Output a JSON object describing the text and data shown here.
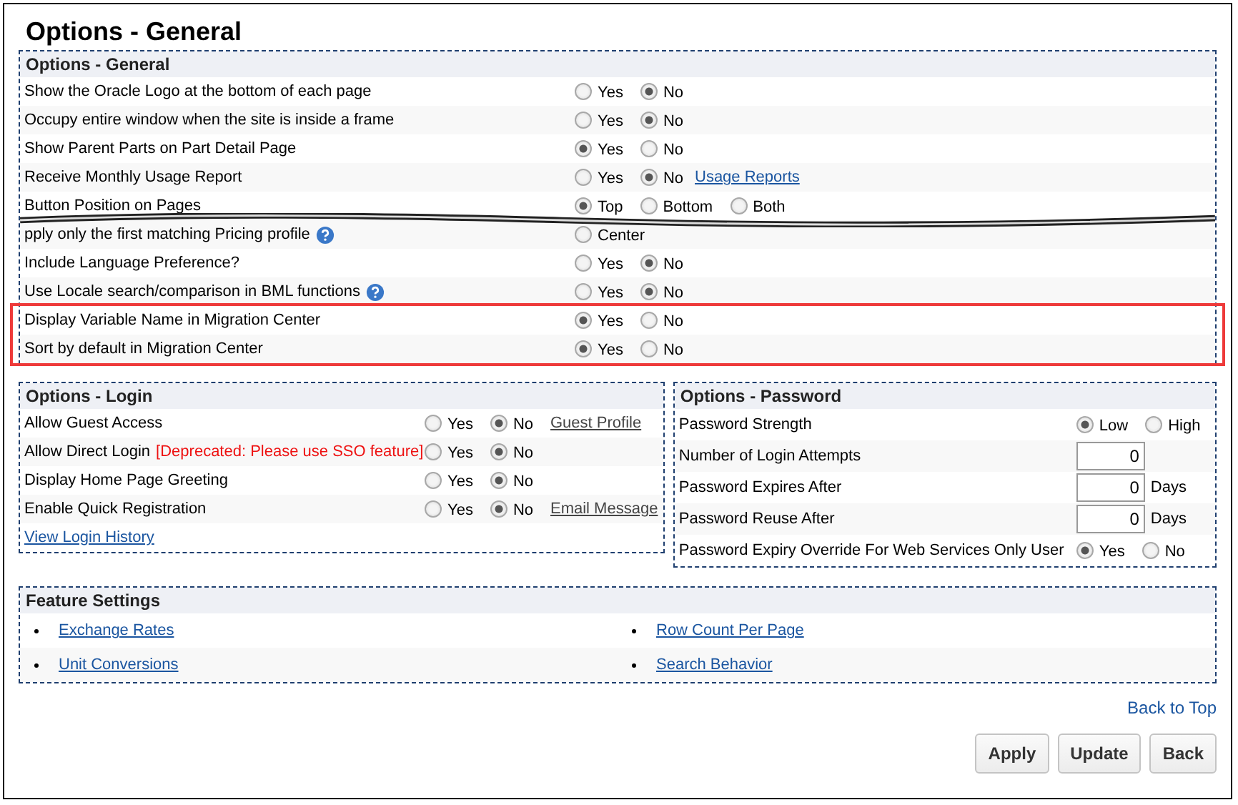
{
  "page_title": "Options - General",
  "general": {
    "title": "Options - General",
    "rows": [
      {
        "label": "Show the Oracle Logo at the bottom of each page",
        "help": false,
        "highlighted": false,
        "options": [
          {
            "label": "Yes",
            "selected": false
          },
          {
            "label": "No",
            "selected": true
          }
        ]
      },
      {
        "label": "Occupy entire window when the site is inside a frame",
        "help": false,
        "highlighted": false,
        "options": [
          {
            "label": "Yes",
            "selected": false
          },
          {
            "label": "No",
            "selected": true
          }
        ]
      },
      {
        "label": "Show Parent Parts on Part Detail Page",
        "help": false,
        "highlighted": false,
        "options": [
          {
            "label": "Yes",
            "selected": true
          },
          {
            "label": "No",
            "selected": false
          }
        ]
      },
      {
        "label": "Receive Monthly Usage Report",
        "help": false,
        "highlighted": false,
        "options": [
          {
            "label": "Yes",
            "selected": false
          },
          {
            "label": "No",
            "selected": true
          }
        ],
        "link": "Usage Reports"
      },
      {
        "label": "Button Position on Pages",
        "help": false,
        "highlighted": false,
        "options": [
          {
            "label": "Top",
            "selected": true
          },
          {
            "label": "Bottom",
            "selected": false
          },
          {
            "label": "Both",
            "selected": false
          }
        ],
        "tear_after": true
      },
      {
        "label": "pply only the first matching Pricing profile",
        "help": true,
        "highlighted": false,
        "options": [
          {
            "label": "Center",
            "selected": false
          }
        ]
      },
      {
        "label": "Include Language Preference?",
        "help": false,
        "highlighted": false,
        "options": [
          {
            "label": "Yes",
            "selected": false
          },
          {
            "label": "No",
            "selected": true
          }
        ]
      },
      {
        "label": "Use Locale search/comparison in BML functions",
        "help": true,
        "highlighted": false,
        "options": [
          {
            "label": "Yes",
            "selected": false
          },
          {
            "label": "No",
            "selected": true
          }
        ]
      },
      {
        "label": "Display Variable Name in Migration Center",
        "help": false,
        "highlighted": true,
        "options": [
          {
            "label": "Yes",
            "selected": true
          },
          {
            "label": "No",
            "selected": false
          }
        ]
      },
      {
        "label": "Sort by default in Migration Center",
        "help": false,
        "highlighted": true,
        "options": [
          {
            "label": "Yes",
            "selected": true
          },
          {
            "label": "No",
            "selected": false
          }
        ]
      }
    ]
  },
  "login": {
    "title": "Options - Login",
    "rows": [
      {
        "label": "Allow Guest Access",
        "options": [
          {
            "label": "Yes",
            "selected": false
          },
          {
            "label": "No",
            "selected": true
          }
        ],
        "link": "Guest Profile"
      },
      {
        "label": "Allow Direct Login",
        "warning": "[Deprecated: Please use SSO feature]",
        "options": [
          {
            "label": "Yes",
            "selected": false
          },
          {
            "label": "No",
            "selected": true
          }
        ]
      },
      {
        "label": "Display Home Page Greeting",
        "options": [
          {
            "label": "Yes",
            "selected": false
          },
          {
            "label": "No",
            "selected": true
          }
        ]
      },
      {
        "label": "Enable Quick Registration",
        "options": [
          {
            "label": "Yes",
            "selected": false
          },
          {
            "label": "No",
            "selected": true
          }
        ],
        "link": "Email Message"
      }
    ],
    "history_link": "View Login History"
  },
  "password": {
    "title": "Options - Password",
    "rows": [
      {
        "kind": "radio",
        "label": "Password Strength",
        "options": [
          {
            "label": "Low",
            "selected": true
          },
          {
            "label": "High",
            "selected": false
          }
        ]
      },
      {
        "kind": "number",
        "label": "Number of Login Attempts",
        "value": "0"
      },
      {
        "kind": "number",
        "label": "Password Expires After",
        "value": "0",
        "unit": "Days"
      },
      {
        "kind": "number",
        "label": "Password Reuse After",
        "value": "0",
        "unit": "Days"
      },
      {
        "kind": "radio",
        "label": "Password Expiry Override For Web Services Only User",
        "options": [
          {
            "label": "Yes",
            "selected": true
          },
          {
            "label": "No",
            "selected": false
          }
        ]
      }
    ]
  },
  "features": {
    "title": "Feature Settings",
    "links": [
      "Exchange Rates",
      "Row Count Per Page",
      "Unit Conversions",
      "Search Behavior"
    ]
  },
  "back_to_top": "Back to Top",
  "buttons": [
    "Apply",
    "Update",
    "Back"
  ]
}
